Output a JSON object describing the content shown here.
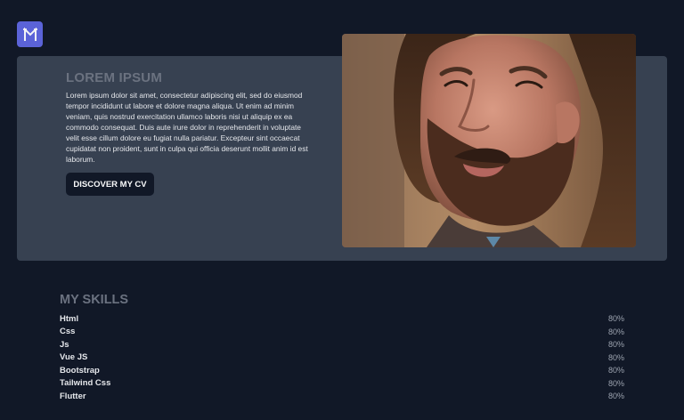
{
  "brand": {
    "logo_icon": "m-monogram-icon",
    "color": "#5b63d8"
  },
  "hero": {
    "title": "LOREM IPSUM",
    "text": "Lorem ipsum dolor sit amet, consectetur adipiscing elit, sed do eiusmod tempor incididunt ut labore et dolore magna aliqua. Ut enim ad minim veniam, quis nostrud exercitation ullamco laboris nisi ut aliquip ex ea commodo consequat. Duis aute irure dolor in reprehenderit in voluptate velit esse cillum dolore eu fugiat nulla pariatur. Excepteur sint occaecat cupidatat non proident, sunt in culpa qui officia deserunt mollit anim id est laborum.",
    "button_label": "DISCOVER MY CV",
    "photo_icon": "profile-photo"
  },
  "skills": {
    "title": "MY SKILLS",
    "items": [
      {
        "name": "Html",
        "value": "80%"
      },
      {
        "name": "Css",
        "value": "80%"
      },
      {
        "name": "Js",
        "value": "80%"
      },
      {
        "name": "Vue JS",
        "value": "80%"
      },
      {
        "name": "Bootstrap",
        "value": "80%"
      },
      {
        "name": "Tailwind Css",
        "value": "80%"
      },
      {
        "name": "Flutter",
        "value": "80%"
      }
    ]
  },
  "colors": {
    "page_background": "#111827",
    "card_background": "#374151",
    "muted_heading": "#6b7280"
  }
}
